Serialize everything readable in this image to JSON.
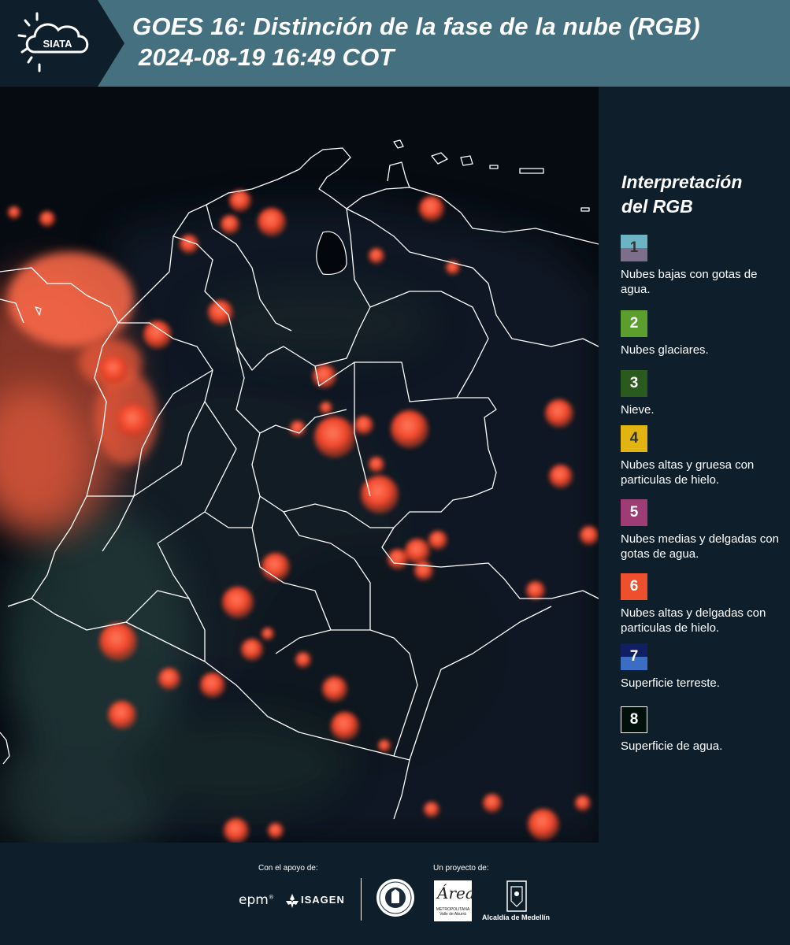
{
  "header": {
    "logo_text": "SIATA",
    "title_line1": "GOES 16: Distinción de la fase de la nube (RGB)",
    "title_line2": "2024-08-19 16:49 COT"
  },
  "legend": {
    "title_line1": "Interpretación",
    "title_line2": "del RGB",
    "items": [
      {
        "num": "1",
        "desc": "Nubes bajas con gotas de agua.",
        "color_top": "#6cb4c4",
        "color_bottom": "#7d6f8c",
        "text_color": "#333333"
      },
      {
        "num": "2",
        "desc": "Nubes glaciares.",
        "color_top": "#5c9e2e",
        "color_bottom": "#5c9e2e",
        "text_color": "#ffffff"
      },
      {
        "num": "3",
        "desc": "Nieve.",
        "color_top": "#2b5a1e",
        "color_bottom": "#2b5a1e",
        "text_color": "#ffffff"
      },
      {
        "num": "4",
        "desc": "Nubes altas y gruesa con particulas de hielo.",
        "color_top": "#e2b412",
        "color_bottom": "#e2b412",
        "text_color": "#333333"
      },
      {
        "num": "5",
        "desc": "Nubes medias y delgadas con gotas de agua.",
        "color_top": "#9e3c76",
        "color_bottom": "#9e3c76",
        "text_color": "#ffffff"
      },
      {
        "num": "6",
        "desc": "Nubes altas y delgadas con particulas de hielo.",
        "color_top": "#ee4f2d",
        "color_bottom": "#ee4f2d",
        "text_color": "#ffffff"
      },
      {
        "num": "7",
        "desc": "Superficie terreste.",
        "color_top": "#111f62",
        "color_bottom": "#3b6ec2",
        "text_color": "#ffffff"
      },
      {
        "num": "8",
        "desc": "Superficie de agua.",
        "color_top": "#02100b",
        "color_bottom": "#02100b",
        "text_color": "#ffffff"
      }
    ]
  },
  "footer": {
    "support_label": "Con el apoyo de:",
    "project_label": "Un proyecto de:",
    "epm": "epm",
    "epm_mark": "®",
    "isagen": "ISAGEN",
    "area_name": "Área",
    "area_sub": "METROPOLITANA Valle de Aburrá",
    "alcaldia": "Alcaldía de Medellín"
  }
}
